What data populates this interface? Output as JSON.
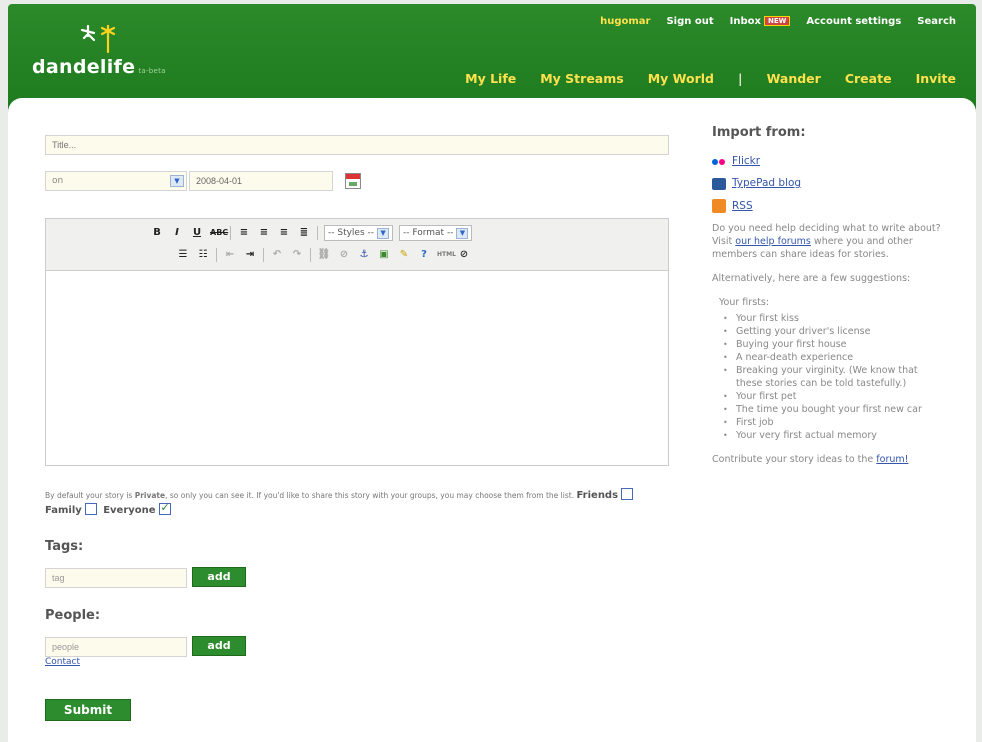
{
  "brand": {
    "name": "dandelife",
    "tagline": "ta-beta"
  },
  "top_nav": {
    "user": "hugomar",
    "sign_out": "Sign out",
    "inbox": "Inbox",
    "inbox_badge": "NEW",
    "account_settings": "Account settings",
    "search": "Search"
  },
  "main_nav": {
    "my_life": "My Life",
    "my_streams": "My Streams",
    "my_world": "My World",
    "separator": "|",
    "wander": "Wander",
    "create": "Create",
    "invite": "Invite"
  },
  "form": {
    "title_placeholder": "Title...",
    "date_qualifier": "on",
    "date": "2008-04-01",
    "toolbar": {
      "styles": "-- Styles --",
      "format": "-- Format --"
    },
    "privacy_text_1": "By default your story is",
    "privacy_bold": "Private",
    "privacy_text_2": ", so only you can see it. If you'd like to share this story with your groups, you may choose them from the list.",
    "groups": [
      {
        "label": "Friends",
        "checked": false
      },
      {
        "label": "Family",
        "checked": false
      },
      {
        "label": "Everyone",
        "checked": true
      }
    ],
    "tags_title": "Tags:",
    "tags_value": "tag",
    "people_title": "People:",
    "people_value": "people",
    "add_label": "add",
    "contact": "Contact",
    "submit": "Submit"
  },
  "sidebar": {
    "import_title": "Import from:",
    "imports": [
      "Flickr",
      "TypePad blog",
      "RSS"
    ],
    "help_1": "Do you need help deciding what to write about? Visit",
    "help_link": "our help forums",
    "help_2": "where you and other members can share ideas for stories.",
    "alt_text": "Alternatively, here are a few suggestions:",
    "firsts_title": "Your firsts:",
    "firsts": [
      "Your first kiss",
      "Getting your driver's license",
      "Buying your first house",
      "A near-death experience",
      "Breaking your virginity. (We know that these stories can be told tastefully.)",
      "Your first pet",
      "The time you bought your first new car",
      "First job",
      "Your very first actual memory"
    ],
    "contribute": "Contribute your story ideas to the",
    "forum_link": "forum!"
  },
  "colors": {
    "brand_green": "#2d8a2a",
    "nav_yellow": "#ffe24d",
    "link_blue": "#3355aa"
  }
}
